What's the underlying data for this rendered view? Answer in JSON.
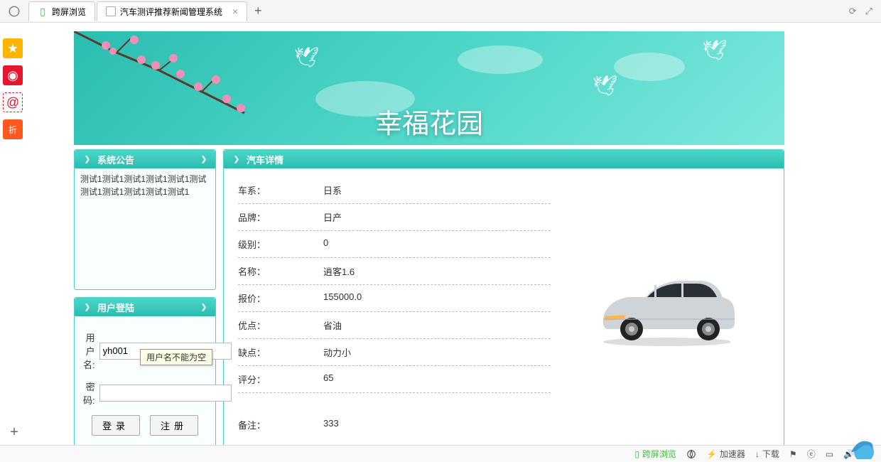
{
  "browser": {
    "tab1_label": "跨屏浏览",
    "tab2_label": "汽车测评推荐新闻管理系统"
  },
  "banner": {
    "title": "幸福花园"
  },
  "panels": {
    "notice_header": "系统公告",
    "login_header": "用户登陆",
    "detail_header": "汽车详情"
  },
  "notice": {
    "line1": "测试1测试1测试1测试1测试1测试1测试1",
    "line2": "测试1测试1测试1测试1测试1"
  },
  "login": {
    "username_label": "用户名:",
    "password_label": "密  码:",
    "username_value": "yh001",
    "login_btn": "登录",
    "register_btn": "注册",
    "tooltip": "用户名不能为空"
  },
  "detail": {
    "rows": [
      {
        "label": "车系：",
        "value": "日系"
      },
      {
        "label": "品牌：",
        "value": "日产"
      },
      {
        "label": "级别：",
        "value": "0"
      },
      {
        "label": "名称：",
        "value": "逍客1.6"
      },
      {
        "label": "报价：",
        "value": "155000.0"
      },
      {
        "label": "优点：",
        "value": "省油"
      },
      {
        "label": "缺点：",
        "value": "动力小"
      },
      {
        "label": "评分：",
        "value": "65"
      }
    ],
    "remark_label": "备注：",
    "remark_value": "333"
  },
  "status": {
    "kuaping": "跨屏浏览",
    "jiasu": "加速器",
    "xiazai": "下载"
  }
}
